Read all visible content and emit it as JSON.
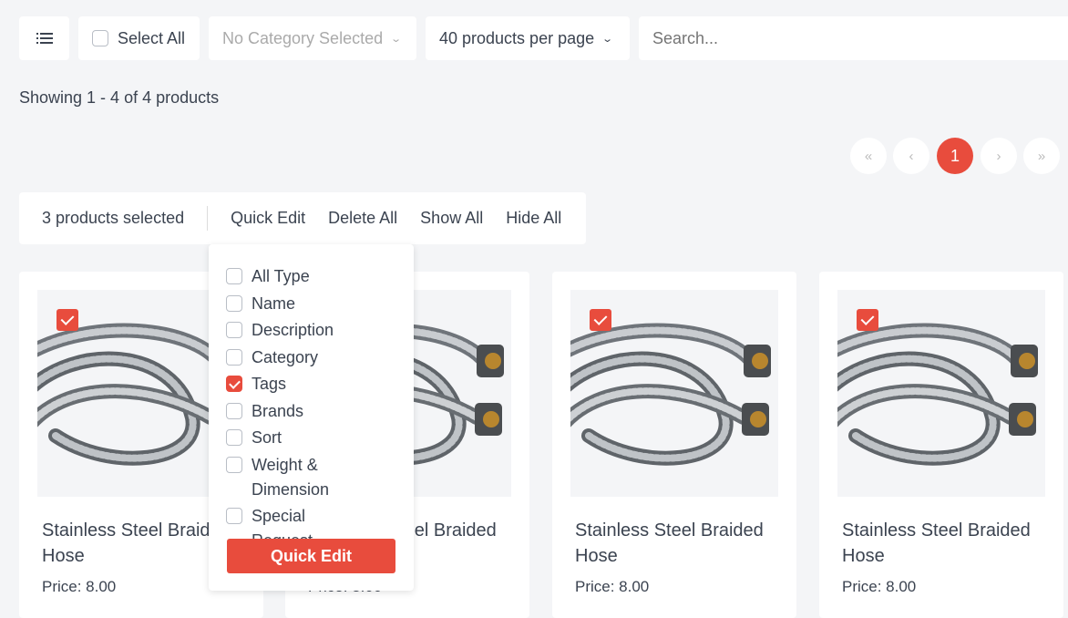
{
  "toolbar": {
    "select_all": "Select All",
    "category": "No Category Selected",
    "per_page": "40 products per page",
    "search_placeholder": "Search..."
  },
  "showing": "Showing 1 - 4 of 4 products",
  "pagination": {
    "first": "«",
    "prev": "‹",
    "current": "1",
    "next": "›",
    "last": "»"
  },
  "bulk": {
    "selected": "3 products selected",
    "quick_edit": "Quick Edit",
    "delete_all": "Delete All",
    "show_all": "Show All",
    "hide_all": "Hide All"
  },
  "dropdown": {
    "options": [
      {
        "label": "All Type",
        "checked": false
      },
      {
        "label": "Name",
        "checked": false
      },
      {
        "label": "Description",
        "checked": false
      },
      {
        "label": "Category",
        "checked": false
      },
      {
        "label": "Tags",
        "checked": true
      },
      {
        "label": "Brands",
        "checked": false
      },
      {
        "label": "Sort",
        "checked": false
      },
      {
        "label": "Weight & Dimension",
        "checked": false
      },
      {
        "label": "Special Request",
        "checked": false
      }
    ],
    "button": "Quick Edit"
  },
  "products": [
    {
      "title": "Stainless Steel Braided Hose",
      "price": "Price: 8.00",
      "selected": true
    },
    {
      "title": "Stainless Steel Braided Hose",
      "price": "Price: 8.00",
      "selected": false
    },
    {
      "title": "Stainless Steel Braided Hose",
      "price": "Price: 8.00",
      "selected": true
    },
    {
      "title": "Stainless Steel Braided Hose",
      "price": "Price: 8.00",
      "selected": true
    }
  ],
  "colors": {
    "accent": "#e84c3d",
    "background": "#f4f5f7"
  }
}
